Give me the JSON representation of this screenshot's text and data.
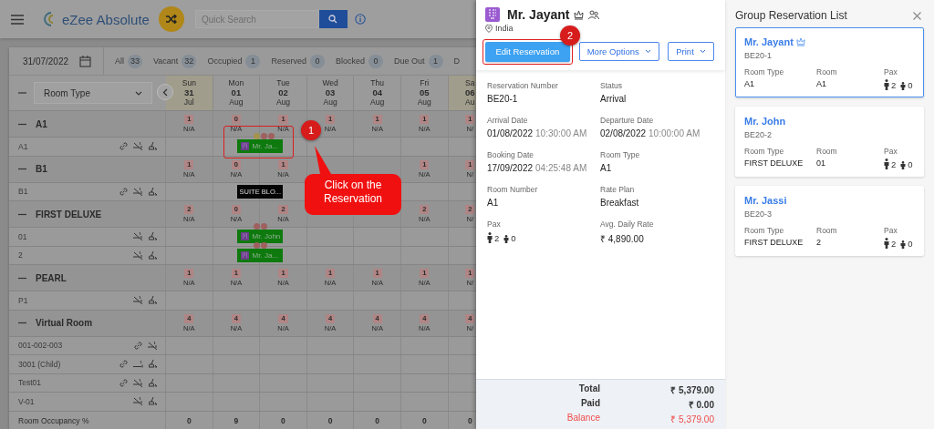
{
  "topbar": {
    "brand": "eZee Absolute",
    "search": {
      "placeholder": "Quick Search"
    }
  },
  "filter_bar": {
    "date": "31/07/2022",
    "filters": [
      {
        "label": "All",
        "count": "33"
      },
      {
        "label": "Vacant",
        "count": "32"
      },
      {
        "label": "Occupied",
        "count": "1"
      },
      {
        "label": "Reserved",
        "count": "0"
      },
      {
        "label": "Blocked",
        "count": "0"
      },
      {
        "label": "Due Out",
        "count": "1"
      },
      {
        "label": "D"
      }
    ]
  },
  "grid": {
    "room_type_select": "Room Type",
    "days": [
      {
        "day": "Sun",
        "date": "31",
        "month": "Jul",
        "weekend": true
      },
      {
        "day": "Mon",
        "date": "01",
        "month": "Aug",
        "weekend": false
      },
      {
        "day": "Tue",
        "date": "02",
        "month": "Aug",
        "weekend": false
      },
      {
        "day": "Wed",
        "date": "03",
        "month": "Aug",
        "weekend": false
      },
      {
        "day": "Thu",
        "date": "04",
        "month": "Aug",
        "weekend": false
      },
      {
        "day": "Fri",
        "date": "05",
        "month": "Aug",
        "weekend": false
      },
      {
        "day": "Sa",
        "date": "06",
        "month": "Au",
        "weekend": true
      }
    ],
    "groups": [
      {
        "name": "A1",
        "expanded": true,
        "cells": [
          {
            "count": "1",
            "rate": "N/A"
          },
          {
            "count": "0",
            "rate": "N/A"
          },
          {
            "count": "1",
            "rate": "N/A"
          },
          {
            "count": "1",
            "rate": "N/A"
          },
          {
            "count": "1",
            "rate": "N/A"
          },
          {
            "count": "1",
            "rate": "N/A"
          },
          {
            "count": "1",
            "rate": "N/"
          }
        ],
        "rooms": [
          {
            "name": "A1",
            "linked": true,
            "smoking": false,
            "cleaning": true,
            "cells": [
              null,
              {
                "kind": "reservation",
                "label": "Mr. Ja...",
                "vip": true,
                "highlighted": true
              },
              null,
              null,
              null,
              null,
              null
            ]
          }
        ]
      },
      {
        "name": "B1",
        "expanded": true,
        "cells": [
          {
            "count": "1",
            "rate": "N/A"
          },
          {
            "count": "0",
            "rate": "N/A"
          },
          {
            "count": "1",
            "rate": "N/A"
          },
          null,
          null,
          {
            "count": "1",
            "rate": "N/A"
          },
          {
            "count": "1",
            "rate": "N/"
          }
        ],
        "rooms": [
          {
            "name": "B1",
            "linked": true,
            "smoking": false,
            "cleaning": true,
            "cells": [
              null,
              {
                "kind": "block",
                "label": "SUITE BLO...",
                "vip": false,
                "highlighted": false
              },
              null,
              null,
              null,
              null,
              null
            ]
          }
        ]
      },
      {
        "name": "FIRST DELUXE",
        "expanded": true,
        "cells": [
          {
            "count": "2",
            "rate": "N/A"
          },
          {
            "count": "0",
            "rate": "N/A"
          },
          {
            "count": "2",
            "rate": "N/A"
          },
          null,
          null,
          {
            "count": "2",
            "rate": "N/A"
          },
          {
            "count": "2",
            "rate": "N/"
          }
        ],
        "rooms": [
          {
            "name": "01",
            "linked": false,
            "smoking": false,
            "cleaning": true,
            "cells": [
              null,
              {
                "kind": "reservation",
                "label": "Mr. John",
                "vip": false,
                "highlighted": false
              },
              null,
              null,
              null,
              null,
              null
            ]
          },
          {
            "name": "2",
            "linked": false,
            "smoking": false,
            "cleaning": true,
            "cells": [
              null,
              {
                "kind": "reservation",
                "label": "Mr. Ja...",
                "vip": false,
                "highlighted": false
              },
              null,
              null,
              null,
              null,
              null
            ]
          }
        ]
      },
      {
        "name": "PEARL",
        "expanded": true,
        "cells": [
          {
            "count": "1",
            "rate": "N/A"
          },
          {
            "count": "1",
            "rate": "N/A"
          },
          {
            "count": "1",
            "rate": "N/A"
          },
          {
            "count": "1",
            "rate": "N/A"
          },
          {
            "count": "1",
            "rate": "N/A"
          },
          {
            "count": "1",
            "rate": "N/A"
          },
          {
            "count": "1",
            "rate": "N/"
          }
        ],
        "rooms": [
          {
            "name": "P1",
            "linked": false,
            "smoking": false,
            "cleaning": true,
            "cells": [
              null,
              null,
              null,
              null,
              null,
              null,
              null
            ]
          }
        ]
      },
      {
        "name": "Virtual Room",
        "expanded": true,
        "cells": [
          {
            "count": "4",
            "rate": "N/A"
          },
          {
            "count": "4",
            "rate": "N/A"
          },
          {
            "count": "4",
            "rate": "N/A"
          },
          {
            "count": "4",
            "rate": "N/A"
          },
          {
            "count": "4",
            "rate": "N/A"
          },
          {
            "count": "4",
            "rate": "N/A"
          },
          {
            "count": "4",
            "rate": "N/"
          }
        ],
        "rooms": [
          {
            "name": "001-002-003",
            "linked": true,
            "smoking": false,
            "cleaning": false,
            "cells": [
              null,
              null,
              null,
              null,
              null,
              null,
              null
            ]
          },
          {
            "name": "3001 (Child)",
            "linked": true,
            "smoking": true,
            "cleaning": true,
            "cells": [
              null,
              null,
              null,
              null,
              null,
              null,
              null
            ]
          },
          {
            "name": "Test01",
            "linked": true,
            "smoking": false,
            "cleaning": true,
            "cells": [
              null,
              null,
              null,
              null,
              null,
              null,
              null
            ]
          },
          {
            "name": "V-01",
            "linked": false,
            "smoking": false,
            "cleaning": true,
            "cells": [
              null,
              null,
              null,
              null,
              null,
              null,
              null
            ]
          }
        ]
      }
    ],
    "occupancy": {
      "label": "Room Occupancy %",
      "values": [
        "0",
        "9",
        "0",
        "0",
        "0",
        "0",
        "0"
      ]
    }
  },
  "annotations": [
    {
      "kind": "step",
      "label": "1"
    },
    {
      "kind": "callout",
      "text": "Click on the Reservation"
    },
    {
      "kind": "step",
      "label": "2"
    }
  ],
  "detail": {
    "guest": "Mr. Jayant",
    "vip": true,
    "group": true,
    "country": "India",
    "buttons": [
      {
        "label": "Edit Reservation",
        "kind": "primary",
        "highlighted": true
      },
      {
        "label": "More Options",
        "kind": "dropdown",
        "highlighted": false
      },
      {
        "label": "Print",
        "kind": "dropdown",
        "highlighted": false
      }
    ],
    "fields": [
      {
        "label": "Reservation Number",
        "value": "BE20-1"
      },
      {
        "label": "Status",
        "value": "Arrival"
      },
      {
        "label": "Arrival Date",
        "value": "01/08/2022",
        "time": "10:30:00 AM"
      },
      {
        "label": "Departure Date",
        "value": "02/08/2022",
        "time": "10:00:00 AM"
      },
      {
        "label": "Booking Date",
        "value": "17/09/2022",
        "time": "04:25:48 AM"
      },
      {
        "label": "Room Type",
        "value": "A1"
      },
      {
        "label": "Room Number",
        "value": "A1"
      },
      {
        "label": "Rate Plan",
        "value": "Breakfast"
      },
      {
        "label": "Pax",
        "kind": "pax",
        "adults": "2",
        "children": "0"
      },
      {
        "label": "Avg. Daily Rate",
        "value": "₹ 4,890.00"
      }
    ],
    "totals": [
      {
        "label": "Total",
        "value": "₹ 5,379.00",
        "due": false
      },
      {
        "label": "Paid",
        "value": "₹ 0.00",
        "due": false
      },
      {
        "label": "Balance",
        "value": "₹ 5,379.00",
        "due": true
      }
    ]
  },
  "group_list": {
    "title": "Group Reservation List",
    "reservations": [
      {
        "guest": "Mr. Jayant",
        "vip": true,
        "number": "BE20-1",
        "selected": true,
        "fields": [
          {
            "label": "Room Type",
            "value": "A1"
          },
          {
            "label": "Room",
            "value": "A1"
          },
          {
            "label": "Pax",
            "kind": "pax",
            "adults": "2",
            "children": "0"
          }
        ]
      },
      {
        "guest": "Mr. John",
        "vip": false,
        "number": "BE20-2",
        "selected": false,
        "fields": [
          {
            "label": "Room Type",
            "value": "FIRST DELUXE"
          },
          {
            "label": "Room",
            "value": "01"
          },
          {
            "label": "Pax",
            "kind": "pax",
            "adults": "2",
            "children": "0"
          }
        ]
      },
      {
        "guest": "Mr. Jassi",
        "vip": false,
        "number": "BE20-3",
        "selected": false,
        "fields": [
          {
            "label": "Room Type",
            "value": "FIRST DELUXE"
          },
          {
            "label": "Room",
            "value": "2"
          },
          {
            "label": "Pax",
            "kind": "pax",
            "adults": "2",
            "children": "0"
          }
        ]
      }
    ]
  }
}
